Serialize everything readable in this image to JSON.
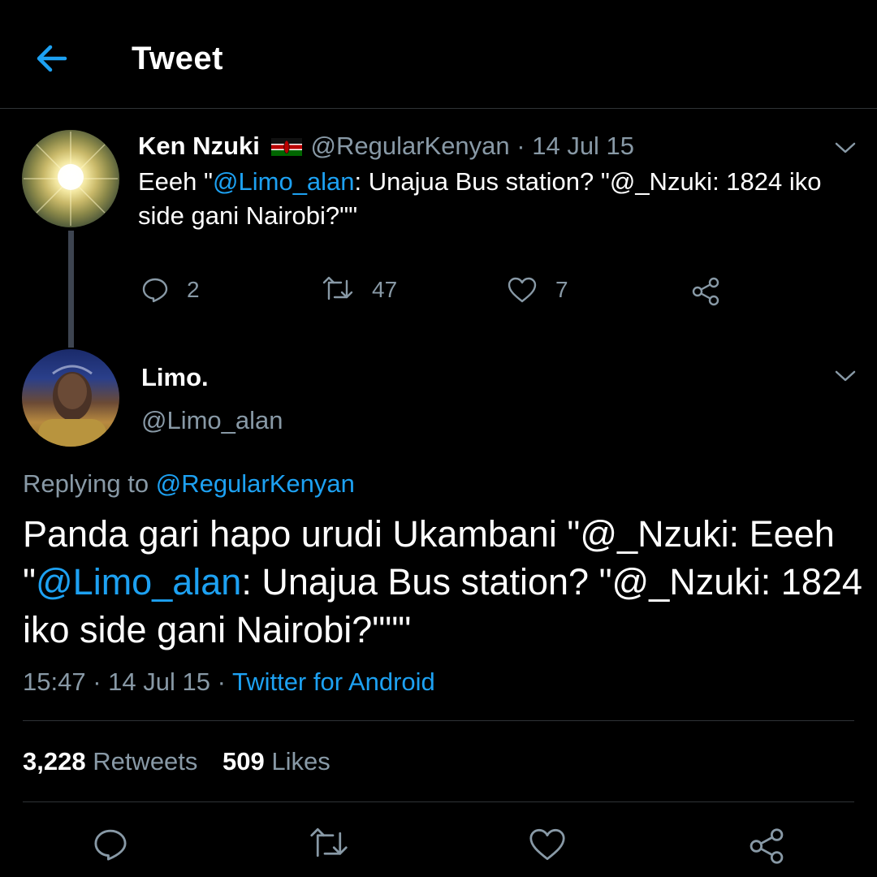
{
  "header": {
    "title": "Tweet",
    "back_icon": "arrow-left-icon",
    "accent_color": "#1da1f2"
  },
  "parent_tweet": {
    "name": "Ken Nzuki",
    "flag": "kenya-flag-emoji",
    "handle": "@RegularKenyan",
    "separator": " · ",
    "date": "14 Jul 15",
    "text_pre": "Eeeh \"",
    "mention": "@Limo_alan",
    "text_post": ": Unajua Bus station? \"@_Nzuki: 1824 iko side gani Nairobi?\"\"",
    "replies": "2",
    "retweets": "47",
    "likes": "7"
  },
  "main_tweet": {
    "name": "Limo.",
    "handle": "@Limo_alan",
    "replying_label": "Replying to ",
    "replying_to": "@RegularKenyan",
    "text_line1": "Panda gari hapo urudi Ukambani \"@_Nzuki: Eeeh",
    "text_quote": "\"",
    "mention": "@Limo_alan",
    "text_rest": ": Unajua Bus station? \"@_Nzuki: 1824 iko side gani Nairobi?\"\"\"",
    "time": "15:47",
    "date_sep": " · ",
    "date": "14 Jul 15",
    "client_sep": " · ",
    "client": "Twitter for Android",
    "retweet_count": "3,228",
    "retweet_label": " Retweets",
    "like_count": "509",
    "like_label": " Likes"
  },
  "bottom_actions": [
    "reply-icon",
    "retweet-icon",
    "like-icon",
    "share-icon"
  ]
}
